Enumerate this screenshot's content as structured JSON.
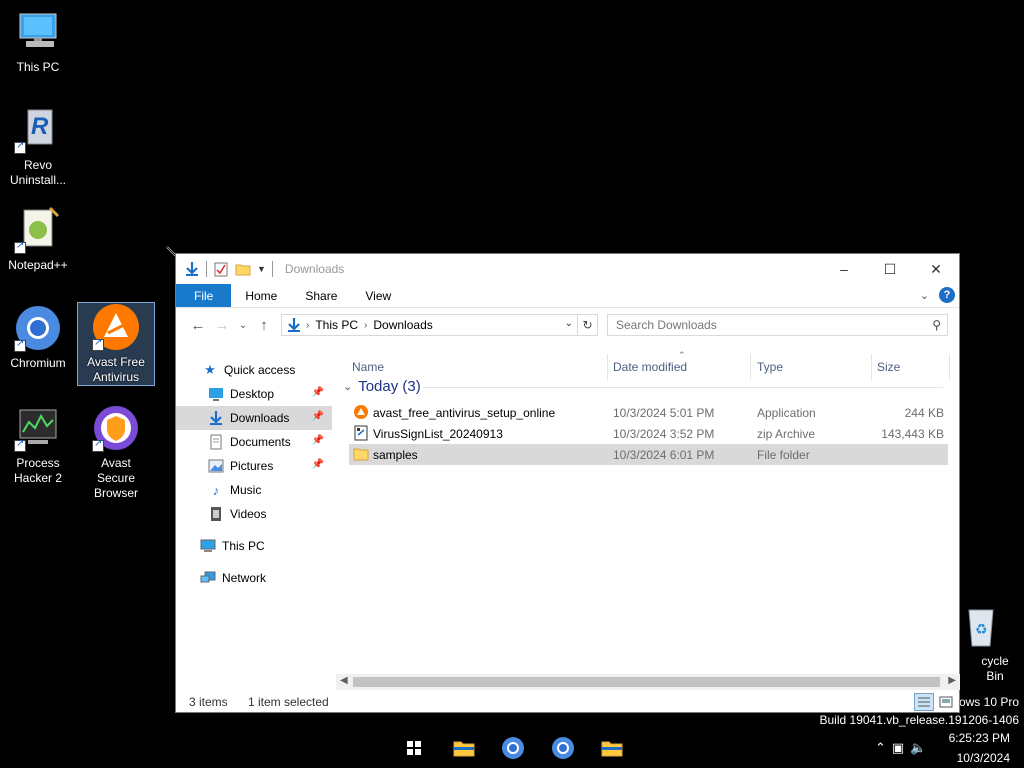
{
  "desktop": {
    "icons": [
      {
        "label": "This PC"
      },
      {
        "label": "Revo Uninstall..."
      },
      {
        "label": "Notepad++"
      },
      {
        "label": "Chromium"
      },
      {
        "label": "Avast Free Antivirus"
      },
      {
        "label": "Process Hacker 2"
      },
      {
        "label": "Avast Secure Browser"
      },
      {
        "label": "cycle Bin"
      }
    ]
  },
  "explorer": {
    "title": "Downloads",
    "ribbon_tabs": [
      "File",
      "Home",
      "Share",
      "View"
    ],
    "address": {
      "crumbs": [
        "This PC",
        "Downloads"
      ]
    },
    "search_placeholder": "Search Downloads",
    "nav": {
      "quick_access": "Quick access",
      "items": [
        "Desktop",
        "Downloads",
        "Documents",
        "Pictures",
        "Music",
        "Videos"
      ],
      "this_pc": "This PC",
      "network": "Network"
    },
    "columns": [
      "Name",
      "Date modified",
      "Type",
      "Size"
    ],
    "group_label": "Today (3)",
    "files": [
      {
        "name": "avast_free_antivirus_setup_online",
        "date": "10/3/2024 5:01 PM",
        "type": "Application",
        "size": "244 KB"
      },
      {
        "name": "VirusSignList_20240913",
        "date": "10/3/2024 3:52 PM",
        "type": "zip Archive",
        "size": "143,443 KB"
      },
      {
        "name": "samples",
        "date": "10/3/2024 6:01 PM",
        "type": "File folder",
        "size": ""
      }
    ],
    "status": {
      "count": "3 items",
      "selection": "1 item selected"
    }
  },
  "watermark": {
    "edition": "ows 10 Pro",
    "build": "Build 19041.vb_release.191206-1406"
  },
  "taskbar": {
    "time": "6:25:23 PM",
    "date": "10/3/2024"
  },
  "colors": {
    "accent": "#1979ca",
    "selected_row": "#d9d9d9",
    "group_header": "#1e3287"
  }
}
